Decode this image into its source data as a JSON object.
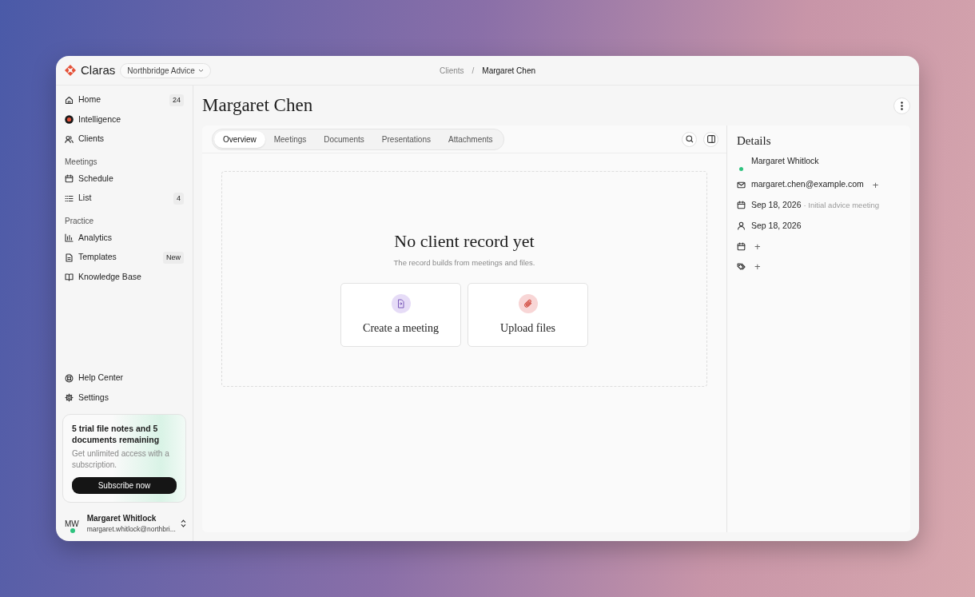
{
  "brand": {
    "name": "Claras",
    "workspace": "Northbridge Advice"
  },
  "breadcrumb_separator": "/",
  "breadcrumb": [
    {
      "label": "Clients",
      "current": false
    },
    {
      "label": "Margaret Chen",
      "current": true
    }
  ],
  "sidebar": {
    "groups": [
      {
        "items": [
          {
            "kind": "home",
            "label": "Home",
            "badge": "24"
          },
          {
            "kind": "intelligence",
            "label": "Intelligence"
          },
          {
            "kind": "clients",
            "label": "Clients"
          }
        ]
      },
      {
        "heading": "Meetings",
        "items": [
          {
            "kind": "calendar",
            "label": "Schedule"
          },
          {
            "kind": "list",
            "label": "List",
            "badge": "4"
          }
        ]
      },
      {
        "heading": "Practice",
        "items": [
          {
            "kind": "chart",
            "label": "Analytics"
          },
          {
            "kind": "document",
            "label": "Templates",
            "badge": "New"
          },
          {
            "kind": "book",
            "label": "Knowledge Base"
          }
        ]
      }
    ],
    "footer_items": [
      {
        "kind": "help",
        "label": "Help Center"
      },
      {
        "kind": "gear",
        "label": "Settings"
      }
    ],
    "promo": {
      "title": "5 trial file notes and 5 documents remaining",
      "text": "Get unlimited access with a subscription.",
      "button": "Subscribe now"
    },
    "user": {
      "initials": "MW",
      "name": "Margaret Whitlock",
      "email": "margaret.whitlock@northbri...",
      "online": true
    }
  },
  "page": {
    "title": "Margaret Chen"
  },
  "tabs": [
    {
      "label": "Overview",
      "selected": true
    },
    {
      "label": "Meetings",
      "selected": false
    },
    {
      "label": "Documents",
      "selected": false
    },
    {
      "label": "Presentations",
      "selected": false
    },
    {
      "label": "Attachments",
      "selected": false
    }
  ],
  "empty_state": {
    "title": "No client record yet",
    "text": "The record builds from meetings and files.",
    "actions": [
      {
        "kind": "meeting",
        "label": "Create a meeting",
        "color": "#e6dcf7"
      },
      {
        "kind": "upload",
        "label": "Upload files",
        "color": "#f8d6d6"
      }
    ]
  },
  "details": {
    "title": "Details",
    "rows": [
      {
        "kind": "owner",
        "text": "Margaret Whitlock"
      },
      {
        "kind": "mail",
        "text": "margaret.chen@example.com",
        "action": "+"
      },
      {
        "kind": "calendar",
        "text": "Sep 18, 2026",
        "note": "· Initial advice meeting"
      },
      {
        "kind": "person",
        "text": "Sep 18, 2026"
      },
      {
        "kind": "calendar",
        "action": "+"
      },
      {
        "kind": "tag",
        "action": "+"
      }
    ]
  }
}
